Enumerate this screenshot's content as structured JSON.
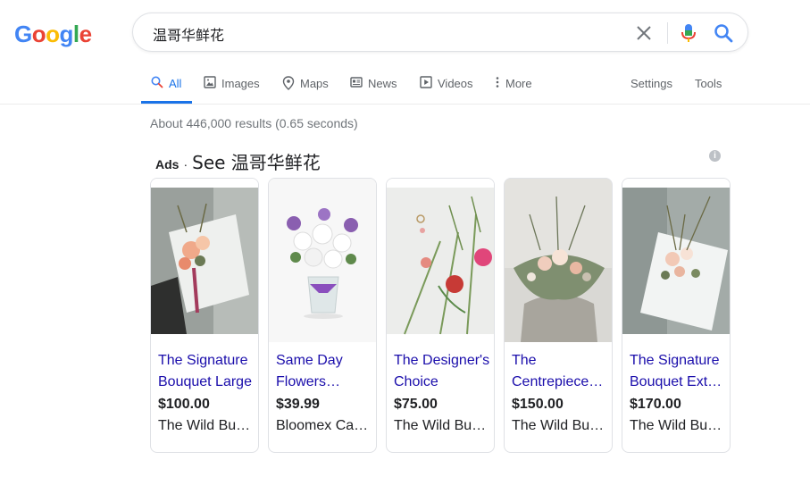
{
  "logo": {
    "letters": [
      "G",
      "o",
      "o",
      "g",
      "l",
      "e"
    ],
    "colors": [
      "#4285f4",
      "#ea4335",
      "#fbbc05",
      "#4285f4",
      "#34a853",
      "#ea4335"
    ]
  },
  "search": {
    "query": "温哥华鲜花"
  },
  "tabs": [
    {
      "label": "All",
      "icon": "search-icon",
      "active": true
    },
    {
      "label": "Images",
      "icon": "image-icon"
    },
    {
      "label": "Maps",
      "icon": "map-pin-icon"
    },
    {
      "label": "News",
      "icon": "newspaper-icon"
    },
    {
      "label": "Videos",
      "icon": "play-icon"
    },
    {
      "label": "More",
      "icon": "more-vertical-icon"
    }
  ],
  "tools": {
    "settings": "Settings",
    "tools": "Tools"
  },
  "results_stats": "About 446,000 results (0.65 seconds)",
  "ads": {
    "label": "Ads",
    "dot": "·",
    "title": "See 温哥华鲜花",
    "info": "i",
    "products": [
      {
        "title": "The Signature Bouquet Large",
        "price": "$100.00",
        "seller": "The Wild Bunch"
      },
      {
        "title": "Same Day Flowers Vancouver",
        "price": "$39.99",
        "seller": "Bloomex Canada"
      },
      {
        "title": "The Designer's Choice",
        "price": "$75.00",
        "seller": "The Wild Bunch"
      },
      {
        "title": "The Centrepiece Arrangement",
        "price": "$150.00",
        "seller": "The Wild Bunch"
      },
      {
        "title": "The Signature Bouquet Extra Large",
        "price": "$170.00",
        "seller": "The Wild Bunch"
      }
    ]
  },
  "colors": {
    "accent": "#1a73e8",
    "link": "#1a0dab",
    "muted": "#70757a",
    "tab_text": "#5f6368"
  }
}
